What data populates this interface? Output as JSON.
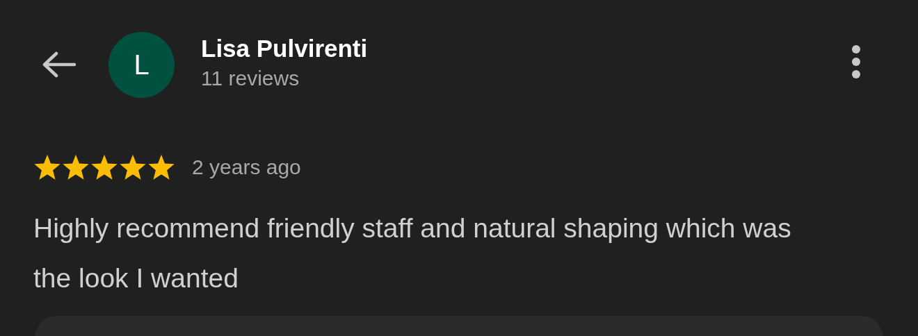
{
  "reviewer": {
    "avatar_letter": "L",
    "name": "Lisa Pulvirenti",
    "review_count": "11 reviews"
  },
  "review": {
    "stars": 5,
    "time": "2 years ago",
    "text": "Highly recommend friendly staff and natural shaping which was the look I wanted"
  }
}
